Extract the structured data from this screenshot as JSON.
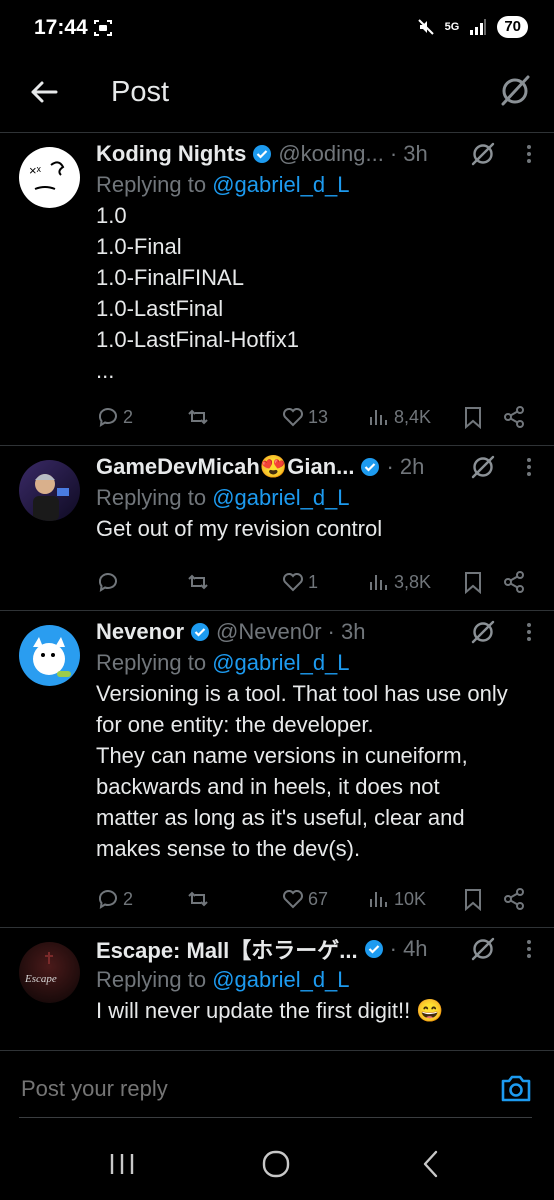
{
  "status_bar": {
    "time": "17:44",
    "network": "5G",
    "battery": "70"
  },
  "header": {
    "title": "Post"
  },
  "replying_prefix": "Replying to",
  "posts": [
    {
      "name": "Koding Nights",
      "handle": "@koding...",
      "time": "· 3h",
      "replying_to": "@gabriel_d_L",
      "lines": [
        "1.0",
        "1.0-Final",
        "1.0-FinalFINAL",
        "1.0-LastFinal",
        "1.0-LastFinal-Hotfix1",
        "..."
      ],
      "replies": "2",
      "reposts": "",
      "likes": "13",
      "views": "8,4K"
    },
    {
      "name": "GameDevMicah😍Gian...",
      "handle": "",
      "time": "· 2h",
      "replying_to": "@gabriel_d_L",
      "lines": [
        "Get out of my revision control"
      ],
      "replies": "",
      "reposts": "",
      "likes": "1",
      "views": "3,8K"
    },
    {
      "name": "Nevenor",
      "handle": "@Neven0r",
      "time": "· 3h",
      "replying_to": "@gabriel_d_L",
      "lines": [
        "Versioning is a tool. That tool has use only",
        "for one entity: the developer.",
        "They can name versions in cuneiform,",
        "backwards and in heels, it does not",
        "matter as long as it's useful, clear and",
        "makes sense to the dev(s)."
      ],
      "replies": "2",
      "reposts": "",
      "likes": "67",
      "views": "10K"
    },
    {
      "name": "Escape: Mall【ホラーゲ...",
      "handle": "",
      "time": "· 4h",
      "replying_to": "@gabriel_d_L",
      "lines": [
        "I will never update the first digit!! 😄"
      ],
      "avatar_text": "Escape"
    }
  ],
  "compose": {
    "placeholder": "Post your reply"
  },
  "colors": {
    "accent": "#1d9bf0",
    "muted": "#71767b",
    "text": "#e7e9ea",
    "background": "#000000"
  }
}
